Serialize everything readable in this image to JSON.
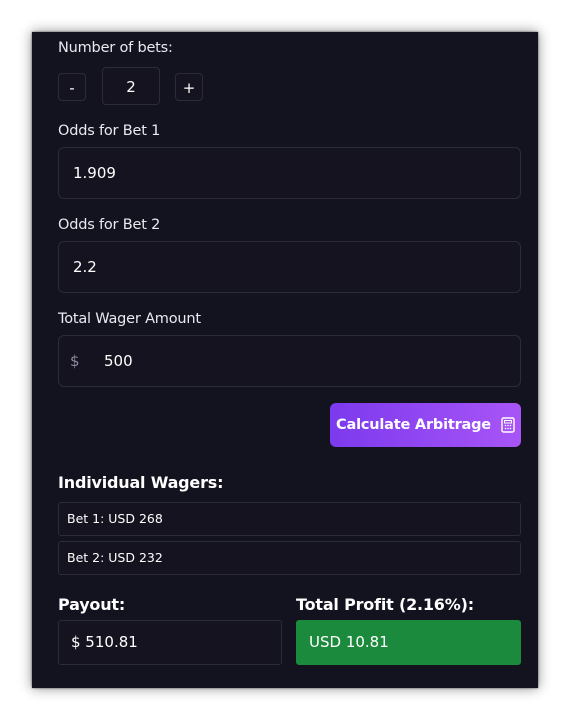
{
  "bets": {
    "label": "Number of bets:",
    "decrement_label": "-",
    "value": "2",
    "increment_label": "+"
  },
  "odds": [
    {
      "label": "Odds for Bet 1",
      "value": "1.909"
    },
    {
      "label": "Odds for Bet 2",
      "value": "2.2"
    }
  ],
  "wager": {
    "label": "Total Wager Amount",
    "currency_symbol": "$",
    "value": "500"
  },
  "calculate_button": {
    "label": "Calculate Arbitrage",
    "icon": "calculator-icon",
    "color": "#8b5cf6"
  },
  "individual_wagers": {
    "title": "Individual Wagers:",
    "items": [
      "Bet 1: USD 268",
      "Bet 2: USD 232"
    ]
  },
  "payout": {
    "label": "Payout:",
    "value": "$ 510.81"
  },
  "profit": {
    "label": "Total Profit (2.16%):",
    "value": "USD 10.81",
    "color": "#1c8a3c"
  }
}
